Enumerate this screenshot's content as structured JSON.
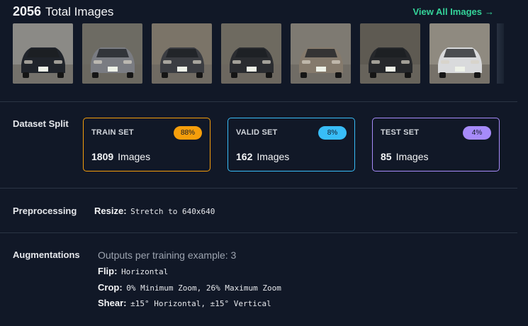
{
  "header": {
    "total_count": "2056",
    "total_label": "Total Images",
    "view_all_label": "View All Images",
    "view_all_arrow": "→"
  },
  "thumbnails": [
    {
      "name": "car-thumb-1",
      "car": "#20242b",
      "bg": "#8b8a86"
    },
    {
      "name": "car-thumb-2",
      "car": "#7a7c82",
      "bg": "#6d6b63"
    },
    {
      "name": "car-thumb-3",
      "car": "#3b3d42",
      "bg": "#7b7468"
    },
    {
      "name": "car-thumb-4",
      "car": "#2a2c30",
      "bg": "#6e6a60"
    },
    {
      "name": "car-thumb-5",
      "car": "#857a6c",
      "bg": "#7e7a72"
    },
    {
      "name": "car-thumb-6",
      "car": "#26282b",
      "bg": "#5e5a52"
    },
    {
      "name": "car-thumb-7",
      "car": "#d9dadc",
      "bg": "#8f8a80"
    }
  ],
  "dataset_split": {
    "label": "Dataset Split",
    "cards": [
      {
        "name": "TRAIN SET",
        "percent": "88%",
        "count": "1809",
        "unit": "Images"
      },
      {
        "name": "VALID SET",
        "percent": "8%",
        "count": "162",
        "unit": "Images"
      },
      {
        "name": "TEST SET",
        "percent": "4%",
        "count": "85",
        "unit": "Images"
      }
    ]
  },
  "preprocessing": {
    "label": "Preprocessing",
    "resize_key": "Resize:",
    "resize_value": "Stretch to 640x640"
  },
  "augmentations": {
    "label": "Augmentations",
    "outputs": "Outputs per training example: 3",
    "items": [
      {
        "key": "Flip:",
        "value": "Horizontal"
      },
      {
        "key": "Crop:",
        "value": "0% Minimum Zoom, 26% Maximum Zoom"
      },
      {
        "key": "Shear:",
        "value": "±15° Horizontal, ±15° Vertical"
      }
    ]
  },
  "colors": {
    "background": "#111827",
    "accent": "#34d399",
    "train": "#f59e0b",
    "valid": "#38bdf8",
    "test": "#a78bfa"
  }
}
